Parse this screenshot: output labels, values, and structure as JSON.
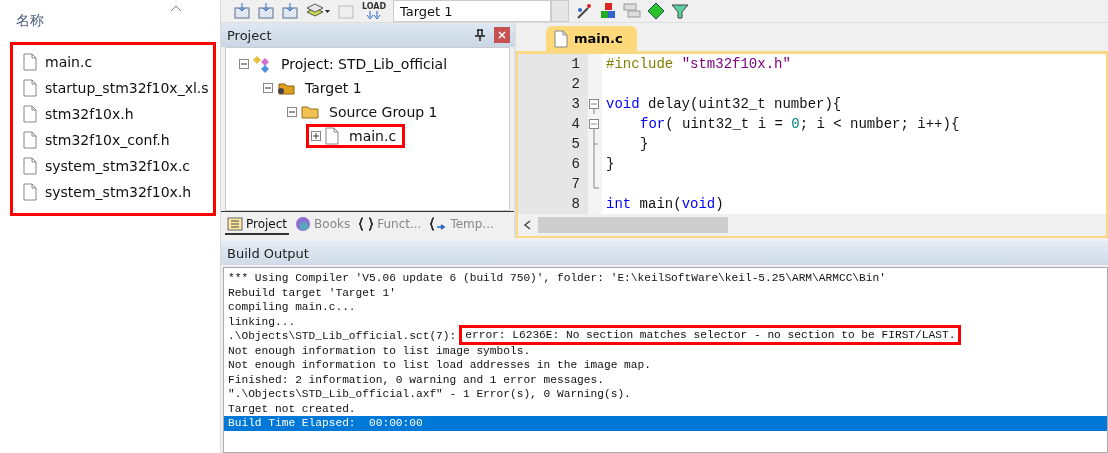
{
  "file_panel": {
    "column_header": "名称",
    "highlighted": true,
    "files": [
      "main.c",
      "startup_stm32f10x_xl.s",
      "stm32f10x.h",
      "stm32f10x_conf.h",
      "system_stm32f10x.c",
      "system_stm32f10x.h"
    ]
  },
  "toolbar": {
    "items": [
      {
        "kind": "icon"
      },
      {
        "kind": "icon"
      },
      {
        "kind": "icon"
      },
      {
        "kind": "dropdown-icon"
      },
      {
        "kind": "disabled-icon"
      },
      {
        "kind": "load",
        "label": "LOAD"
      },
      {
        "kind": "combo",
        "value": "Target 1"
      },
      {
        "kind": "icon"
      },
      {
        "kind": "icon"
      },
      {
        "kind": "icon"
      },
      {
        "kind": "icon"
      },
      {
        "kind": "icon"
      }
    ]
  },
  "project_panel": {
    "title": "Project",
    "tree": [
      {
        "label": "Project: STD_Lib_official",
        "kind": "project",
        "expanded": true,
        "highlighted": false,
        "children": [
          {
            "label": "Target 1",
            "kind": "target",
            "expanded": true,
            "highlighted": false,
            "children": [
              {
                "label": "Source Group 1",
                "kind": "folder",
                "expanded": true,
                "highlighted": false,
                "children": [
                  {
                    "label": "main.c",
                    "kind": "file",
                    "expanded": false,
                    "highlighted": true
                  }
                ]
              }
            ]
          }
        ]
      }
    ],
    "tabs": [
      {
        "label": "Project",
        "selected": true
      },
      {
        "label": "Books",
        "selected": false
      },
      {
        "label": "Funct...",
        "selected": false
      },
      {
        "label": "Temp...",
        "selected": false
      }
    ]
  },
  "editor": {
    "tab": "main.c",
    "lines": [
      {
        "number": "1",
        "kind": "plain",
        "indented": false,
        "tokens": [
          {
            "text": "#include ",
            "kind": "pre"
          },
          {
            "text": "\"stm32f10x.h\"",
            "kind": "string"
          }
        ]
      },
      {
        "number": "2",
        "kind": "plain"
      },
      {
        "number": "3",
        "kind": "fold-start",
        "indented": false,
        "tokens": [
          {
            "text": "void",
            "kind": "keyword"
          },
          {
            "text": " delay(uint32_t number){",
            "kind": "plain"
          }
        ]
      },
      {
        "number": "4",
        "kind": "fold-start",
        "indented": true,
        "tokens": [
          {
            "text": "for",
            "kind": "keyword"
          },
          {
            "text": "( uint32_t i = ",
            "kind": "plain"
          },
          {
            "text": "0",
            "kind": "number"
          },
          {
            "text": "; i < number; i++){",
            "kind": "plain"
          }
        ]
      },
      {
        "number": "5",
        "kind": "fold-inner-end",
        "indented": true,
        "tokens": [
          {
            "text": "}",
            "kind": "plain"
          }
        ]
      },
      {
        "number": "6",
        "kind": "fold-line",
        "indented": false,
        "tokens": [
          {
            "text": "}",
            "kind": "plain"
          }
        ]
      },
      {
        "number": "7",
        "kind": "fold-end"
      },
      {
        "number": "8",
        "kind": "plain",
        "indented": false,
        "tokens": [
          {
            "text": "int",
            "kind": "keyword"
          },
          {
            "text": " main(",
            "kind": "plain"
          },
          {
            "text": "void",
            "kind": "keyword"
          },
          {
            "text": ")",
            "kind": "plain"
          }
        ]
      }
    ]
  },
  "build_output": {
    "title": "Build Output",
    "lines": [
      {
        "text": "*** Using Compiler 'V5.06 update 6 (build 750)', folder: 'E:\\keilSoftWare\\keil-5.25\\ARM\\ARMCC\\Bin'",
        "selected": false
      },
      {
        "text": "Rebuild target 'Target 1'",
        "selected": false
      },
      {
        "text": "compiling main.c...",
        "selected": false
      },
      {
        "text": "linking...",
        "selected": false
      },
      {
        "text": ".\\Objects\\STD_Lib_official.sct(7):",
        "highlighted_text": "error: L6236E: No section matches selector - no section to be FIRST/LAST.",
        "selected": false
      },
      {
        "text": "Not enough information to list image symbols.",
        "selected": false
      },
      {
        "text": "Not enough information to list load addresses in the image map.",
        "selected": false
      },
      {
        "text": "Finished: 2 information, 0 warning and 1 error messages.",
        "selected": false
      },
      {
        "text": "\".\\Objects\\STD_Lib_official.axf\" - 1 Error(s), 0 Warning(s).",
        "selected": false
      },
      {
        "text": "Target not created.",
        "selected": false
      },
      {
        "text": "Build Time Elapsed:  00:00:00",
        "selected": true
      }
    ]
  }
}
